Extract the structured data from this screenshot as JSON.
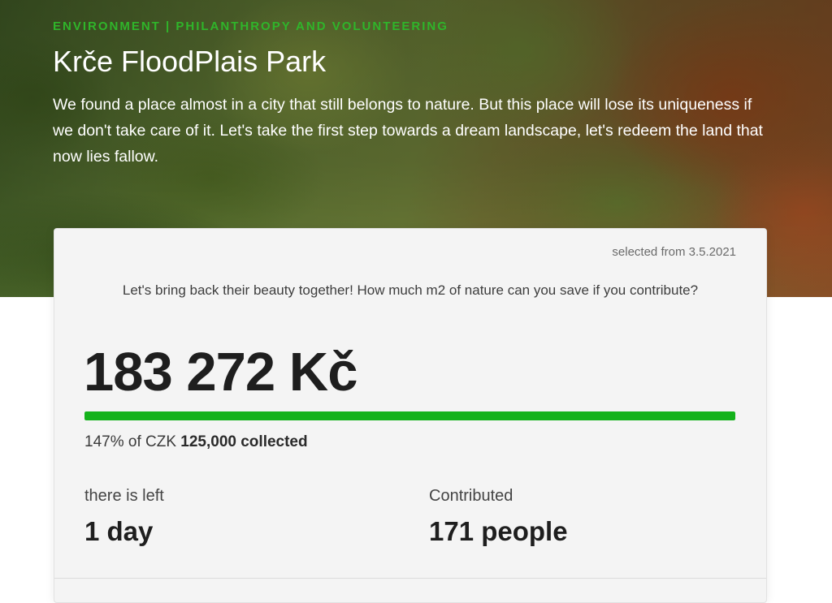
{
  "hero": {
    "category": "ENVIRONMENT | PHILANTHROPY AND VOLUNTEERING",
    "title": "Krče FloodPlais Park",
    "description": "We found a place almost in a city that still belongs to nature. But this place will lose its uniqueness if we don't take care of it. Let's take the first step towards a dream landscape, let's redeem the land that now lies fallow."
  },
  "card": {
    "selected_from": "selected from 3.5.2021",
    "question": "Let's bring back their beauty together! How much m2 of nature can you save if you contribute?",
    "amount": "183 272 Kč",
    "progress_fraction": 1.0,
    "progress_prefix": "147% of CZK ",
    "progress_goal": "125,000 collected",
    "time_left_label": "there is left",
    "time_left_value": "1 day",
    "contributed_label": "Contributed",
    "contributed_value": "171 people"
  },
  "colors": {
    "accent": "#14b21b",
    "category": "#2fb52a"
  }
}
